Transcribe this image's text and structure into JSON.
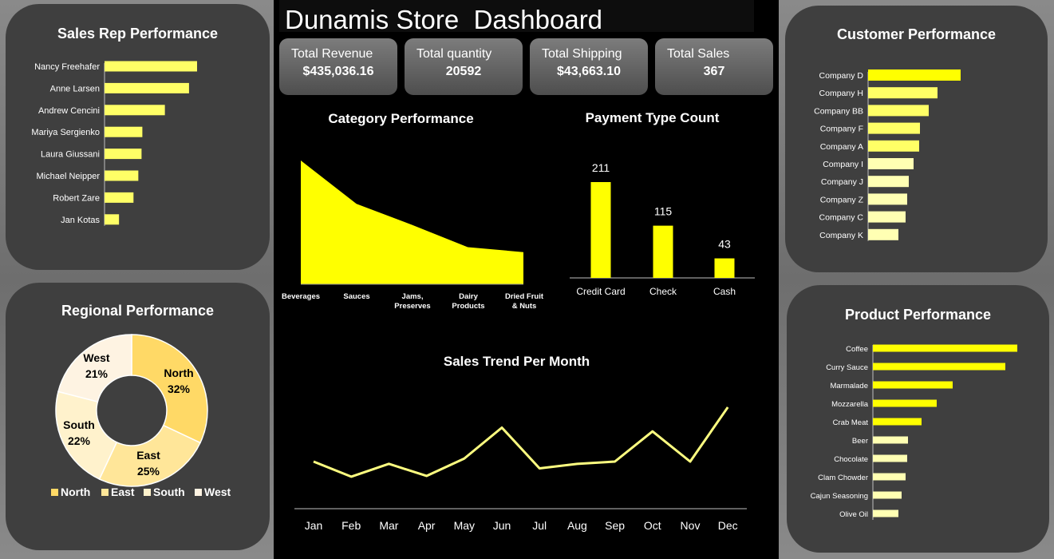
{
  "header": {
    "title": "Dunamis Store  Dashboard"
  },
  "kpis": [
    {
      "label": "Total Revenue",
      "value": "$435,036.16"
    },
    {
      "label": "Total quantity",
      "value": "20592"
    },
    {
      "label": "Total Shipping",
      "value": "$43,663.10"
    },
    {
      "label": "Total Sales",
      "value": "367"
    }
  ],
  "colors": {
    "bright": "#ffff00",
    "mid": "#ffff66",
    "pale": "#ffffb3",
    "line": "#ffff80",
    "panel": "#3f3f3f"
  },
  "chart_data": [
    {
      "id": "sales_rep",
      "type": "bar",
      "orientation": "horizontal",
      "title": "Sales Rep Performance",
      "categories": [
        "Nancy Freehafer",
        "Anne Larsen",
        "Andrew Cencini",
        "Mariya Sergienko",
        "Laura Giussani",
        "Michael Neipper",
        "Robert Zare",
        "Jan Kotas"
      ],
      "values": [
        115,
        105,
        75,
        47,
        46,
        42,
        36,
        18
      ]
    },
    {
      "id": "customer",
      "type": "bar",
      "orientation": "horizontal",
      "title": "Customer Performance",
      "categories": [
        "Company D",
        "Company H",
        "Company BB",
        "Company F",
        "Company A",
        "Company I",
        "Company J",
        "Company Z",
        "Company C",
        "Company K"
      ],
      "values": [
        116,
        87,
        76,
        65,
        64,
        57,
        51,
        49,
        47,
        38
      ]
    },
    {
      "id": "product",
      "type": "bar",
      "orientation": "horizontal",
      "title": "Product Performance",
      "categories": [
        "Coffee",
        "Curry Sauce",
        "Marmalade",
        "Mozzarella",
        "Crab Meat",
        "Beer",
        "Chocolate",
        "Clam Chowder",
        "Cajun Seasoning",
        "Olive Oil"
      ],
      "values": [
        181,
        166,
        100,
        80,
        61,
        44,
        43,
        41,
        36,
        32
      ]
    },
    {
      "id": "region",
      "type": "pie",
      "variant": "doughnut",
      "title": "Regional Performance",
      "legend_position": "bottom",
      "labels": [
        "North",
        "East",
        "South",
        "West"
      ],
      "values": [
        32,
        25,
        22,
        21
      ],
      "value_labels": [
        "32%",
        "25%",
        "22%",
        "21%"
      ],
      "colors": [
        "#ffd966",
        "#ffe699",
        "#fff2cc",
        "#fef3e2"
      ]
    },
    {
      "id": "category",
      "type": "area",
      "title": "Category Performance",
      "categories": [
        "Beverages",
        "Sauces",
        "Jams, Preserves",
        "Dairy Products",
        "Dried Fruit & Nuts"
      ],
      "values": [
        100,
        65,
        48,
        30,
        26
      ]
    },
    {
      "id": "payment",
      "type": "bar",
      "title": "Payment Type Count",
      "categories": [
        "Credit Card",
        "Check",
        "Cash"
      ],
      "values": [
        211,
        115,
        43
      ],
      "value_labels": [
        "211",
        "115",
        "43"
      ]
    },
    {
      "id": "trend",
      "type": "line",
      "title": "Sales Trend Per Month",
      "categories": [
        "Jan",
        "Feb",
        "Mar",
        "Apr",
        "May",
        "Jun",
        "Jul",
        "Aug",
        "Sep",
        "Oct",
        "Nov",
        "Dec"
      ],
      "values": [
        55,
        35,
        52,
        36,
        59,
        100,
        46,
        52,
        55,
        95,
        55,
        127
      ]
    }
  ]
}
